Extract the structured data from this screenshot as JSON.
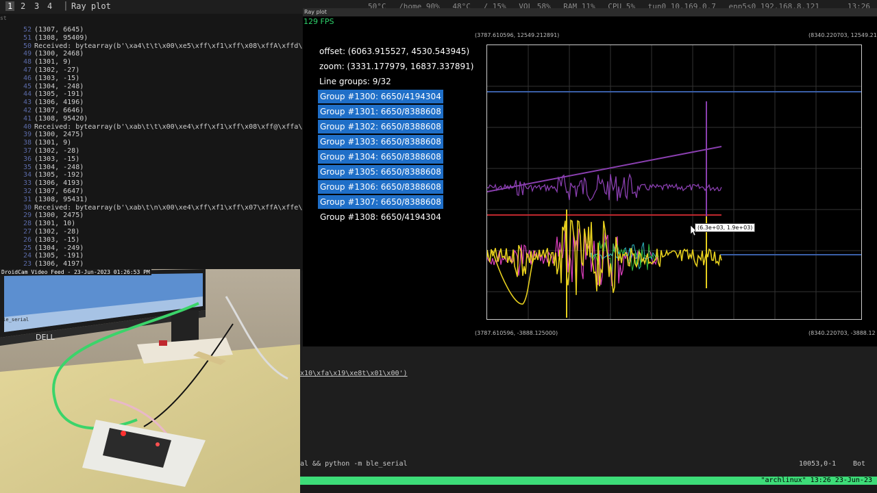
{
  "topbar": {
    "workspaces": [
      "1",
      "2",
      "3",
      "4"
    ],
    "active_workspace": "1",
    "window_title": "Ray plot",
    "status": [
      "50°C",
      "/home 90%",
      "48°C",
      "/ 15%",
      "VOL 58%",
      "RAM 11%",
      "CPU 5%",
      "tun0 10.169.0.7",
      "enp5s0 192.168.8.121"
    ],
    "clock": "13:26"
  },
  "terminal": {
    "header": "st",
    "lines": [
      {
        "n": "52",
        "t": "(1307, 6645)"
      },
      {
        "n": "51",
        "t": "(1308, 95409)"
      },
      {
        "n": "50",
        "t": "Received: bytearray(b'\\xa4\\t\\t\\x00\\xe5\\xff\\xf1\\xff\\x08\\xffA\\xffd\\x",
        "rcv": true
      },
      {
        "n": "49",
        "t": "(1300, 2468)"
      },
      {
        "n": "48",
        "t": "(1301, 9)"
      },
      {
        "n": "47",
        "t": "(1302, -27)"
      },
      {
        "n": "46",
        "t": "(1303, -15)"
      },
      {
        "n": "45",
        "t": "(1304, -248)"
      },
      {
        "n": "44",
        "t": "(1305, -191)"
      },
      {
        "n": "43",
        "t": "(1306, 4196)"
      },
      {
        "n": "42",
        "t": "(1307, 6646)"
      },
      {
        "n": "41",
        "t": "(1308, 95420)"
      },
      {
        "n": "40",
        "t": "Received: bytearray(b'\\xab\\t\\t\\x00\\xe4\\xff\\xf1\\xff\\x08\\xff@\\xffa\\x",
        "rcv": true
      },
      {
        "n": "39",
        "t": "(1300, 2475)"
      },
      {
        "n": "38",
        "t": "(1301, 9)"
      },
      {
        "n": "37",
        "t": "(1302, -28)"
      },
      {
        "n": "36",
        "t": "(1303, -15)"
      },
      {
        "n": "35",
        "t": "(1304, -248)"
      },
      {
        "n": "34",
        "t": "(1305, -192)"
      },
      {
        "n": "33",
        "t": "(1306, 4193)"
      },
      {
        "n": "32",
        "t": "(1307, 6647)"
      },
      {
        "n": "31",
        "t": "(1308, 95431)"
      },
      {
        "n": "30",
        "t": "Received: bytearray(b'\\xab\\t\\n\\x00\\xe4\\xff\\xf1\\xff\\x07\\xffA\\xffe\\x",
        "rcv": true
      },
      {
        "n": "29",
        "t": "(1300, 2475)"
      },
      {
        "n": "28",
        "t": "(1301, 10)"
      },
      {
        "n": "27",
        "t": "(1302, -28)"
      },
      {
        "n": "26",
        "t": "(1303, -15)"
      },
      {
        "n": "25",
        "t": "(1304, -249)"
      },
      {
        "n": "24",
        "t": "(1305, -191)"
      },
      {
        "n": "23",
        "t": "(1306, 4197)"
      }
    ]
  },
  "camera": {
    "title": "DroidCam Video Feed - 23-Jun-2023 01:26:53 PM",
    "monitor_brand": "DELL",
    "screen_text": "ble_serial"
  },
  "plot": {
    "window_title": "Ray plot",
    "fps": "129 FPS",
    "offset": "offset: (6063.915527, 4530.543945)",
    "zoom": "zoom: (3331.177979, 16837.337891)",
    "line_groups": "Line groups: 9/32",
    "groups": [
      {
        "label": "Group #1300: 6650/4194304",
        "selected": true
      },
      {
        "label": "Group #1301: 6650/8388608",
        "selected": true
      },
      {
        "label": "Group #1302: 6650/8388608",
        "selected": true
      },
      {
        "label": "Group #1303: 6650/8388608",
        "selected": true
      },
      {
        "label": "Group #1304: 6650/8388608",
        "selected": true
      },
      {
        "label": "Group #1305: 6650/8388608",
        "selected": true
      },
      {
        "label": "Group #1306: 6650/8388608",
        "selected": true
      },
      {
        "label": "Group #1307: 6650/8388608",
        "selected": true
      },
      {
        "label": "Group #1308: 6650/4194304",
        "selected": false
      }
    ],
    "corner_tl": "(3787.610596, 12549.212891)",
    "corner_tr": "(8340.220703, 12549.21",
    "corner_bl": "(3787.610596, -3888.125000)",
    "corner_br": "(8340.220703, -3888.12",
    "tooltip": "(6.3e+03, 1.9e+03)",
    "colors": {
      "yellow": "#e6cf1e",
      "magenta": "#e040c0",
      "purple": "#8a3fb0",
      "red": "#c0282e",
      "blue": "#3a5fa8",
      "cyan": "#30c0c8",
      "green": "#30c040"
    }
  },
  "bottom_terminal": {
    "line1": "x10\\xfa\\x19\\xe8t\\x01\\x00')",
    "command": "al && python -m ble_serial",
    "position": "10053,0-1",
    "scroll": "Bot",
    "tmux_status": "\"archlinux\" 13:26 23-Jun-23"
  }
}
